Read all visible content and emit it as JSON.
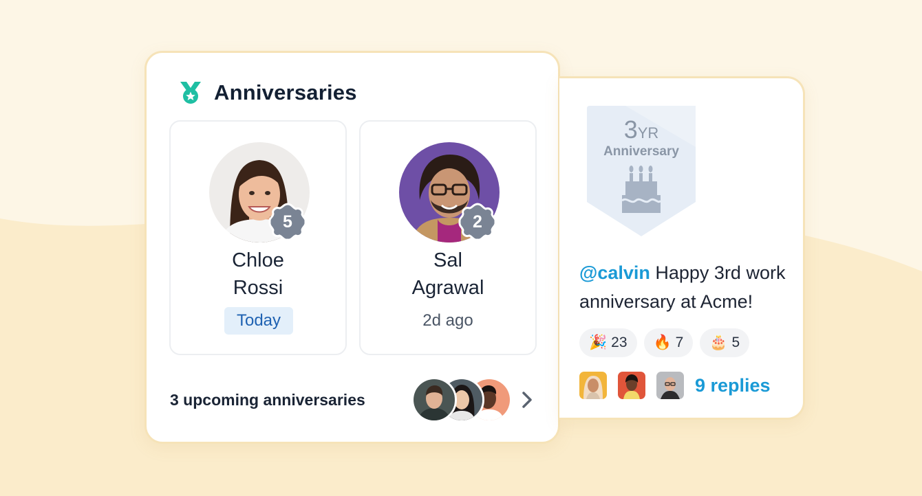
{
  "anniversaries": {
    "title": "Anniversaries",
    "people": [
      {
        "name_line1": "Chloe",
        "name_line2": "Rossi",
        "years": "5",
        "when": "Today"
      },
      {
        "name_line1": "Sal",
        "name_line2": "Agrawal",
        "years": "2",
        "when": "2d ago"
      }
    ],
    "upcoming_label": "3 upcoming anniversaries"
  },
  "post": {
    "badge_years": "3",
    "badge_years_suffix": "YR",
    "badge_label": "Anniversary",
    "mention": "@calvin",
    "message": " Happy 3rd work anniversary at Acme!",
    "reactions": [
      {
        "emoji": "🎉",
        "count": "23"
      },
      {
        "emoji": "🔥",
        "count": "7"
      },
      {
        "emoji": "🎂",
        "count": "5"
      }
    ],
    "replies_label": "9 replies"
  },
  "colors": {
    "background": "#fdf5e4",
    "card_border": "#f6e3b8",
    "medal_teal": "#1fbfa3",
    "badge_gray": "#7a8494",
    "link_blue": "#1a9ad6",
    "today_bg": "#e3effa",
    "today_text": "#1f62b2"
  },
  "icons": {
    "header": "medal-icon",
    "next": "chevron-right-icon",
    "badge": "birthday-cake-icon"
  }
}
